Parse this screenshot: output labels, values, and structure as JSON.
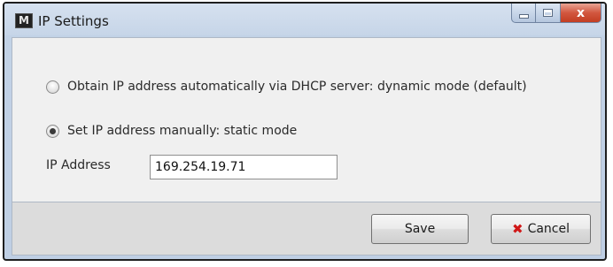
{
  "window": {
    "title": "IP Settings",
    "app_icon_glyph": "M"
  },
  "caption": {
    "minimize_icon": "minimize-icon",
    "maximize_icon": "maximize-icon",
    "close_icon": "close-icon",
    "close_glyph": "x"
  },
  "options": {
    "dhcp": {
      "label": "Obtain IP address automatically via DHCP server: dynamic mode (default)",
      "selected": false
    },
    "static": {
      "label": "Set IP address manually: static mode",
      "selected": true
    }
  },
  "ip_address": {
    "label": "IP Address",
    "value": "169.254.19.71"
  },
  "buttons": {
    "save": "Save",
    "cancel": "Cancel",
    "cancel_icon": "x-icon",
    "cancel_glyph": "✖"
  },
  "colors": {
    "close_button": "#c23d22",
    "cancel_icon": "#d01818"
  }
}
